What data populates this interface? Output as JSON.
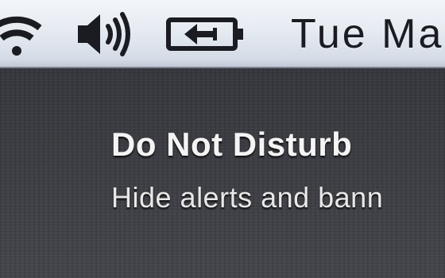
{
  "menubar": {
    "icons": {
      "wifi": "wifi-icon",
      "volume": "volume-icon",
      "battery": "battery-charging-icon"
    },
    "clock": "Tue Ma"
  },
  "notification_center": {
    "do_not_disturb": {
      "title": "Do Not Disturb",
      "subtitle": "Hide alerts and bann"
    }
  },
  "colors": {
    "menubar_background": "#e6ebf2",
    "panel_background": "#3f4046",
    "text_light": "#f4f4f4",
    "icon_dark": "#1a1c22"
  }
}
